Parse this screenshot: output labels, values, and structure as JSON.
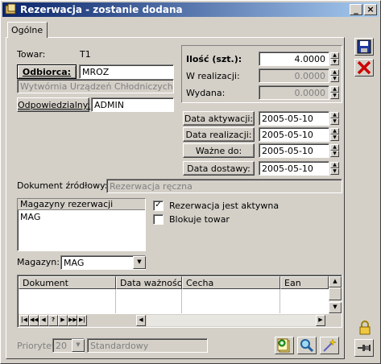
{
  "window": {
    "title": "Rezerwacja - zostanie dodana",
    "minimize": "_",
    "close": "×"
  },
  "tabs": [
    {
      "label": "Ogólne"
    }
  ],
  "towar": {
    "label": "Towar:",
    "value": "T1"
  },
  "odbiorca": {
    "button": "Odbiorca:",
    "code": "MROZ",
    "name": "Wytwórnia Urządzeń Chłodniczych MR"
  },
  "odpowiedzialny": {
    "button": "Odpowiedzialny:",
    "value": "ADMIN"
  },
  "ilosc": {
    "label": "Ilość (szt.):",
    "value": "4.0000",
    "w_realizacji_label": "W realizacji:",
    "w_realizacji": "0.0000",
    "wydana_label": "Wydana:",
    "wydana": "0.0000"
  },
  "dates": [
    {
      "label": "Data aktywacji:",
      "value": "2005-05-10"
    },
    {
      "label": "Data realizacji:",
      "value": "2005-05-10"
    },
    {
      "label": "Ważne do:",
      "value": "2005-05-10"
    },
    {
      "label": "Data  dostawy:",
      "value": "2005-05-10"
    }
  ],
  "dokument": {
    "label": "Dokument źródłowy:",
    "value": "Rezerwacja ręczna"
  },
  "magazyny": {
    "header": "Magazyny rezerwacji",
    "items": [
      "MAG"
    ]
  },
  "checkboxes": [
    {
      "label": "Rezerwacja jest aktywna",
      "checked": true,
      "mark": "✓"
    },
    {
      "label": "Blokuje towar",
      "checked": false,
      "mark": ""
    }
  ],
  "magazyn": {
    "label": "Magazyn:",
    "value": "MAG"
  },
  "grid": {
    "columns": [
      "Dokument",
      "Data ważności",
      "Cecha",
      "Ean"
    ]
  },
  "nav": [
    "|◀",
    "◀◀",
    "◀",
    "?",
    "▶",
    "▶▶",
    "▶|"
  ],
  "priorytet": {
    "label": "Priorytet:",
    "value": "20",
    "text": "Standardowy"
  },
  "side_buttons": {
    "save": "save",
    "cancel": "cancel",
    "lock": "lock",
    "pin": "pin"
  },
  "colors": {
    "title_start": "#0a246a",
    "title_end": "#a6caf0",
    "cancel_red": "#cc0000",
    "save_blue": "#1f3a9e"
  }
}
